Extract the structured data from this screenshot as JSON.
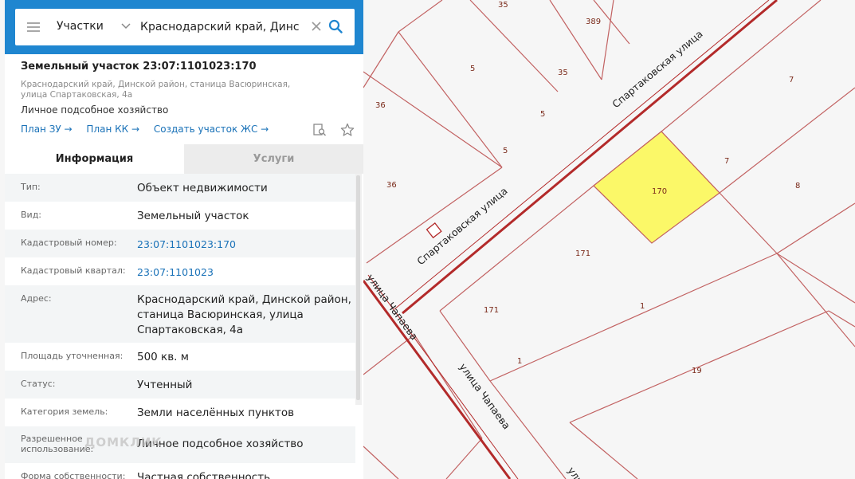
{
  "search": {
    "type_label": "Участки",
    "query": "Краснодарский край, Динско"
  },
  "panel": {
    "title": "Земельный участок 23:07:1101023:170",
    "address": "Краснодарский край, Динской район, станица Васюринская, улица Спартаковская, 4а",
    "purpose": "Личное подсобное хозяйство",
    "links": [
      "План ЗУ →",
      "План КК →",
      "Создать участок ЖС →"
    ]
  },
  "tabs": {
    "info": "Информация",
    "services": "Услуги"
  },
  "info_rows": [
    {
      "label": "Тип:",
      "value": "Объект недвижимости"
    },
    {
      "label": "Вид:",
      "value": "Земельный участок"
    },
    {
      "label": "Кадастровый номер:",
      "value": "23:07:1101023:170"
    },
    {
      "label": "Кадастровый квартал:",
      "value": "23:07:1101023"
    },
    {
      "label": "Адрес:",
      "value": "Краснодарский край, Динской район, станица Васюринская, улица Спартаковская, 4а"
    },
    {
      "label": "Площадь уточненная:",
      "value": "500 кв. м"
    },
    {
      "label": "Статус:",
      "value": "Учтенный"
    },
    {
      "label": "Категория земель:",
      "value": "Земли населённых пунктов"
    },
    {
      "label": "Разрешенное использование:",
      "value": "Личное подсобное хозяйство"
    },
    {
      "label": "Форма собственности:",
      "value": "Частная собственность"
    }
  ],
  "watermark": "ДОМКЛИК",
  "map": {
    "parcel_numbers": [
      "35",
      "389",
      "5",
      "35",
      "7",
      "36",
      "5",
      "5",
      "7",
      "36",
      "170",
      "8",
      "171",
      "171",
      "1",
      "1",
      "19"
    ],
    "streets": [
      "Спартаковская улица",
      "Спартаковская улица",
      "улица Чапаева",
      "улица Чапаева",
      "ули"
    ],
    "highlight_color": "#fbf868",
    "boundary_color": "#b32a2a",
    "accent_color": "#1f86d0"
  }
}
